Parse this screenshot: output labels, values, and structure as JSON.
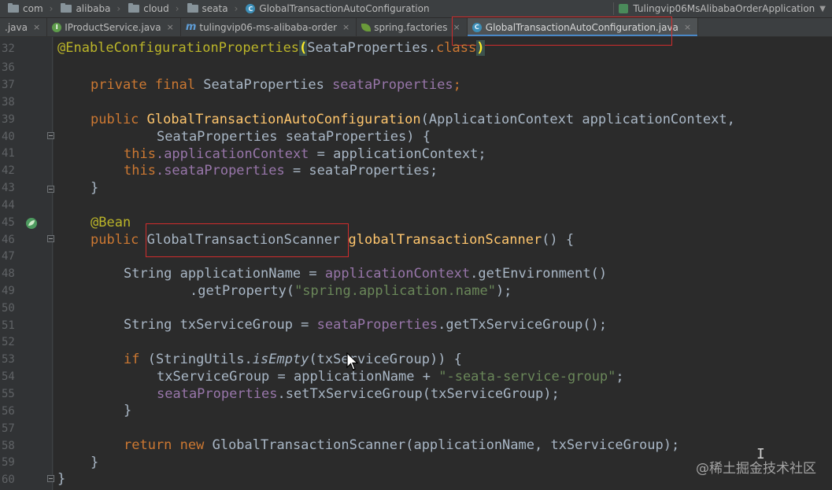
{
  "breadcrumb": {
    "items": [
      {
        "label": "com",
        "icon": "folder-icon"
      },
      {
        "label": "alibaba",
        "icon": "folder-icon"
      },
      {
        "label": "cloud",
        "icon": "folder-icon"
      },
      {
        "label": "seata",
        "icon": "folder-icon"
      },
      {
        "label": "GlobalTransactionAutoConfiguration",
        "icon": "class-icon"
      }
    ],
    "run_config": "Tulingvip06MsAlibabaOrderApplication"
  },
  "tabs": [
    {
      "label": ".java",
      "icon": "none",
      "active": false
    },
    {
      "label": "IProductService.java",
      "icon": "interface-icon",
      "active": false
    },
    {
      "label": "tulingvip06-ms-alibaba-order",
      "icon": "maven-icon",
      "active": false
    },
    {
      "label": "spring.factories",
      "icon": "spring-icon",
      "active": false
    },
    {
      "label": "GlobalTransactionAutoConfiguration.java",
      "icon": "class-icon",
      "active": true
    }
  ],
  "line_numbers": [
    "32",
    "36",
    "37",
    "38",
    "39",
    "40",
    "41",
    "42",
    "43",
    "44",
    "45",
    "46",
    "47",
    "48",
    "49",
    "50",
    "51",
    "52",
    "53",
    "54",
    "55",
    "56",
    "57",
    "58",
    "59",
    "60"
  ],
  "code": {
    "l32": {
      "a": "@EnableConfigurationProperties",
      "b": "(",
      "c": "SeataProperties.",
      "d": "class",
      "e": ")"
    },
    "l37": {
      "kw": "private final ",
      "type": "SeataProperties ",
      "field": "seataProperties",
      "end": ";"
    },
    "l39": {
      "kw": "public ",
      "fn": "GlobalTransactionAutoConfiguration",
      "rest": "(ApplicationContext applicationContext,"
    },
    "l40": {
      "text": "SeataProperties seataProperties) {"
    },
    "l41": {
      "kw": "this",
      "field": ".applicationContext",
      "rest": " = applicationContext;"
    },
    "l42": {
      "kw": "this",
      "field": ".seataProperties",
      "rest": " = seataProperties;"
    },
    "l43": {
      "text": "}"
    },
    "l45": {
      "ann": "@Bean"
    },
    "l46": {
      "kw": "public ",
      "type": "GlobalTransactionScanner",
      "fn": "globalTransactionScanner",
      "rest": "() {"
    },
    "l48": {
      "a": "String applicationName = ",
      "field": "applicationContext",
      "b": ".getEnvironment()"
    },
    "l49": {
      "a": ".getProperty(",
      "str": "\"spring.application.name\"",
      "b": ");"
    },
    "l51": {
      "a": "String txServiceGroup = ",
      "field": "seataProperties",
      "b": ".getTxServiceGroup();"
    },
    "l53": {
      "kw": "if ",
      "a": "(StringUtils.",
      "it": "isEmpty",
      "b": "(txServiceGroup)) {"
    },
    "l54": {
      "a": "txServiceGroup = applicationName + ",
      "str": "\"-seata-service-group\"",
      "b": ";"
    },
    "l55": {
      "field": "seataProperties",
      "b": ".setTxServiceGroup(txServiceGroup);"
    },
    "l56": {
      "text": "}"
    },
    "l58": {
      "kw": "return new ",
      "a": "GlobalTransactionScanner(applicationName, txServiceGroup);"
    },
    "l59": {
      "text": "}"
    },
    "l60": {
      "text": "}"
    }
  },
  "watermark": "@稀土掘金技术社区",
  "colors": {
    "background": "#2b2b2b",
    "keyword": "#cc7832",
    "function": "#ffc66d",
    "field": "#9876aa",
    "string": "#6a8759",
    "annotation": "#bbb529",
    "highlight_box": "#d12d2d"
  }
}
